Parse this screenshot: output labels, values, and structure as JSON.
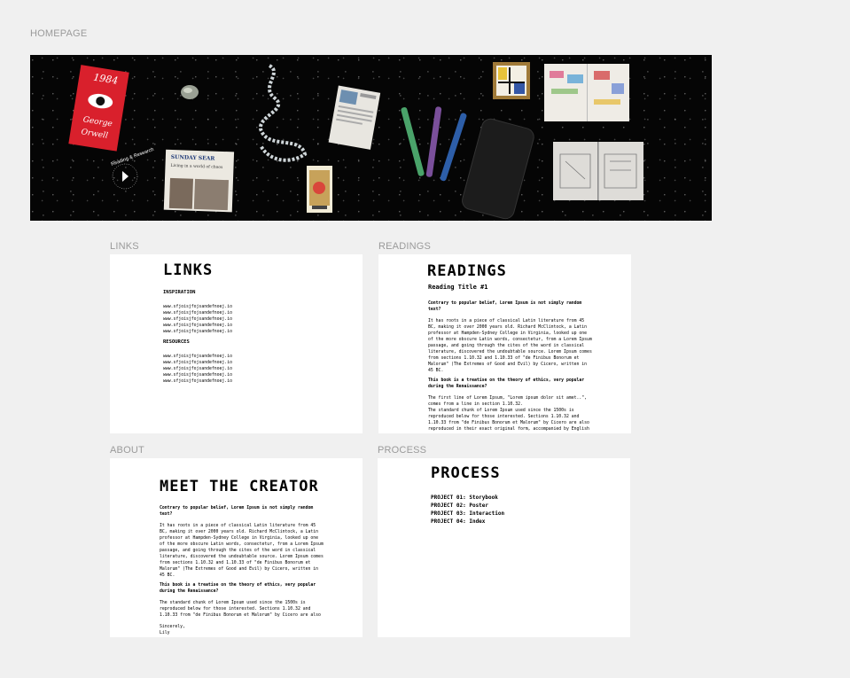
{
  "page": {
    "homepage_label": "HOMEPAGE",
    "links_label": "LINKS",
    "readings_label": "READINGS",
    "about_label": "ABOUT",
    "process_label": "PROCESS"
  },
  "hero": {
    "book_year": "1984",
    "book_author_line1": "George",
    "book_author_line2": "Orwell",
    "newspaper_title": "SUNDAY SEAR",
    "newspaper_headline": "Living in a world of chaos",
    "badge_text": "Reading & Research"
  },
  "links_frame": {
    "title": "LINKS",
    "inspiration_heading": "INSPIRATION",
    "inspiration_links": [
      "www.sfjoisjfojsandefnoej.io",
      "www.sfjoisjfojsandefnoej.io",
      "www.sfjoisjfojsandefnoej.io",
      "www.sfjoisjfojsandefnoej.io",
      "www.sfjoisjfojsandefnoej.io"
    ],
    "resources_heading": "RESOURCES",
    "resources_links": [
      "www.sfjoisjfojsandefnoej.io",
      "www.sfjoisjfojsandefnoej.io",
      "www.sfjoisjfojsandefnoej.io",
      "www.sfjoisjfojsandefnoej.io",
      "www.sfjoisjfojsandefnoej.io"
    ]
  },
  "readings_frame": {
    "title": "READINGS",
    "reading_title": "Reading Title #1",
    "q1": "Contrary to popular belief, Lorem Ipsum is not simply random\ntext?",
    "p1": "It has roots in a piece of classical Latin literature from 45\nBC, making it over 2000 years old. Richard McClintock, a Latin\nprofessor at Hampden-Sydney College in Virginia, looked up one\nof the more obscure Latin words, consectetur, from a Lorem Ipsum\npassage, and going through the cites of the word in classical\nliterature, discovered the undoubtable source. Lorem Ipsum comes\nfrom sections 1.10.32 and 1.10.33 of \"de Finibus Bonorum et\nMalorum\" (The Extremes of Good and Evil) by Cicero, written in\n45 BC.",
    "q2": "This book is a treatise on the theory of ethics, very popular\nduring the Renaissance?",
    "p2": "The first line of Lorem Ipsum, \"Lorem ipsum dolor sit amet..\",\ncomes from a line in section 1.10.32.\nThe standard chunk of Lorem Ipsum used since the 1500s is\nreproduced below for those interested. Sections 1.10.32 and\n1.10.33 from \"de Finibus Bonorum et Malorum\" by Cicero are also\nreproduced in their exact original form, accompanied by English"
  },
  "about_frame": {
    "title": "MEET THE CREATOR",
    "q1": "Contrary to popular belief, Lorem Ipsum is not simply random\ntext?",
    "p1": "It has roots in a piece of classical Latin literature from 45\nBC, making it over 2000 years old. Richard McClintock, a Latin\nprofessor at Hampden-Sydney College in Virginia, looked up one\nof the more obscure Latin words, consectetur, from a Lorem Ipsum\npassage, and going through the cites of the word in classical\nliterature, discovered the undoubtable source. Lorem Ipsum comes\nfrom sections 1.10.32 and 1.10.33 of \"de Finibus Bonorum et\nMalorum\" (The Extremes of Good and Evil) by Cicero, written in\n45 BC.",
    "q2": "This book is a treatise on the theory of ethics, very popular\nduring the Renaissance?",
    "p2": "The standard chunk of Lorem Ipsum used since the 1500s is\nreproduced below for those interested. Sections 1.10.32 and\n1.10.33 from \"de Finibus Bonorum et Malorum\" by Cicero are also",
    "signoff": "Sincerely,\nLily"
  },
  "process_frame": {
    "title": "PROCESS",
    "projects": [
      "PROJECT 01: Storybook",
      "PROJECT 02: Poster",
      "PROJECT 03: Interaction",
      "PROJECT 04: Index"
    ]
  },
  "colors": {
    "canvas_bg": "#f0f0f0",
    "label_gray": "#9a9a9a",
    "hero_bg": "#050505",
    "book_red": "#d9202c"
  }
}
